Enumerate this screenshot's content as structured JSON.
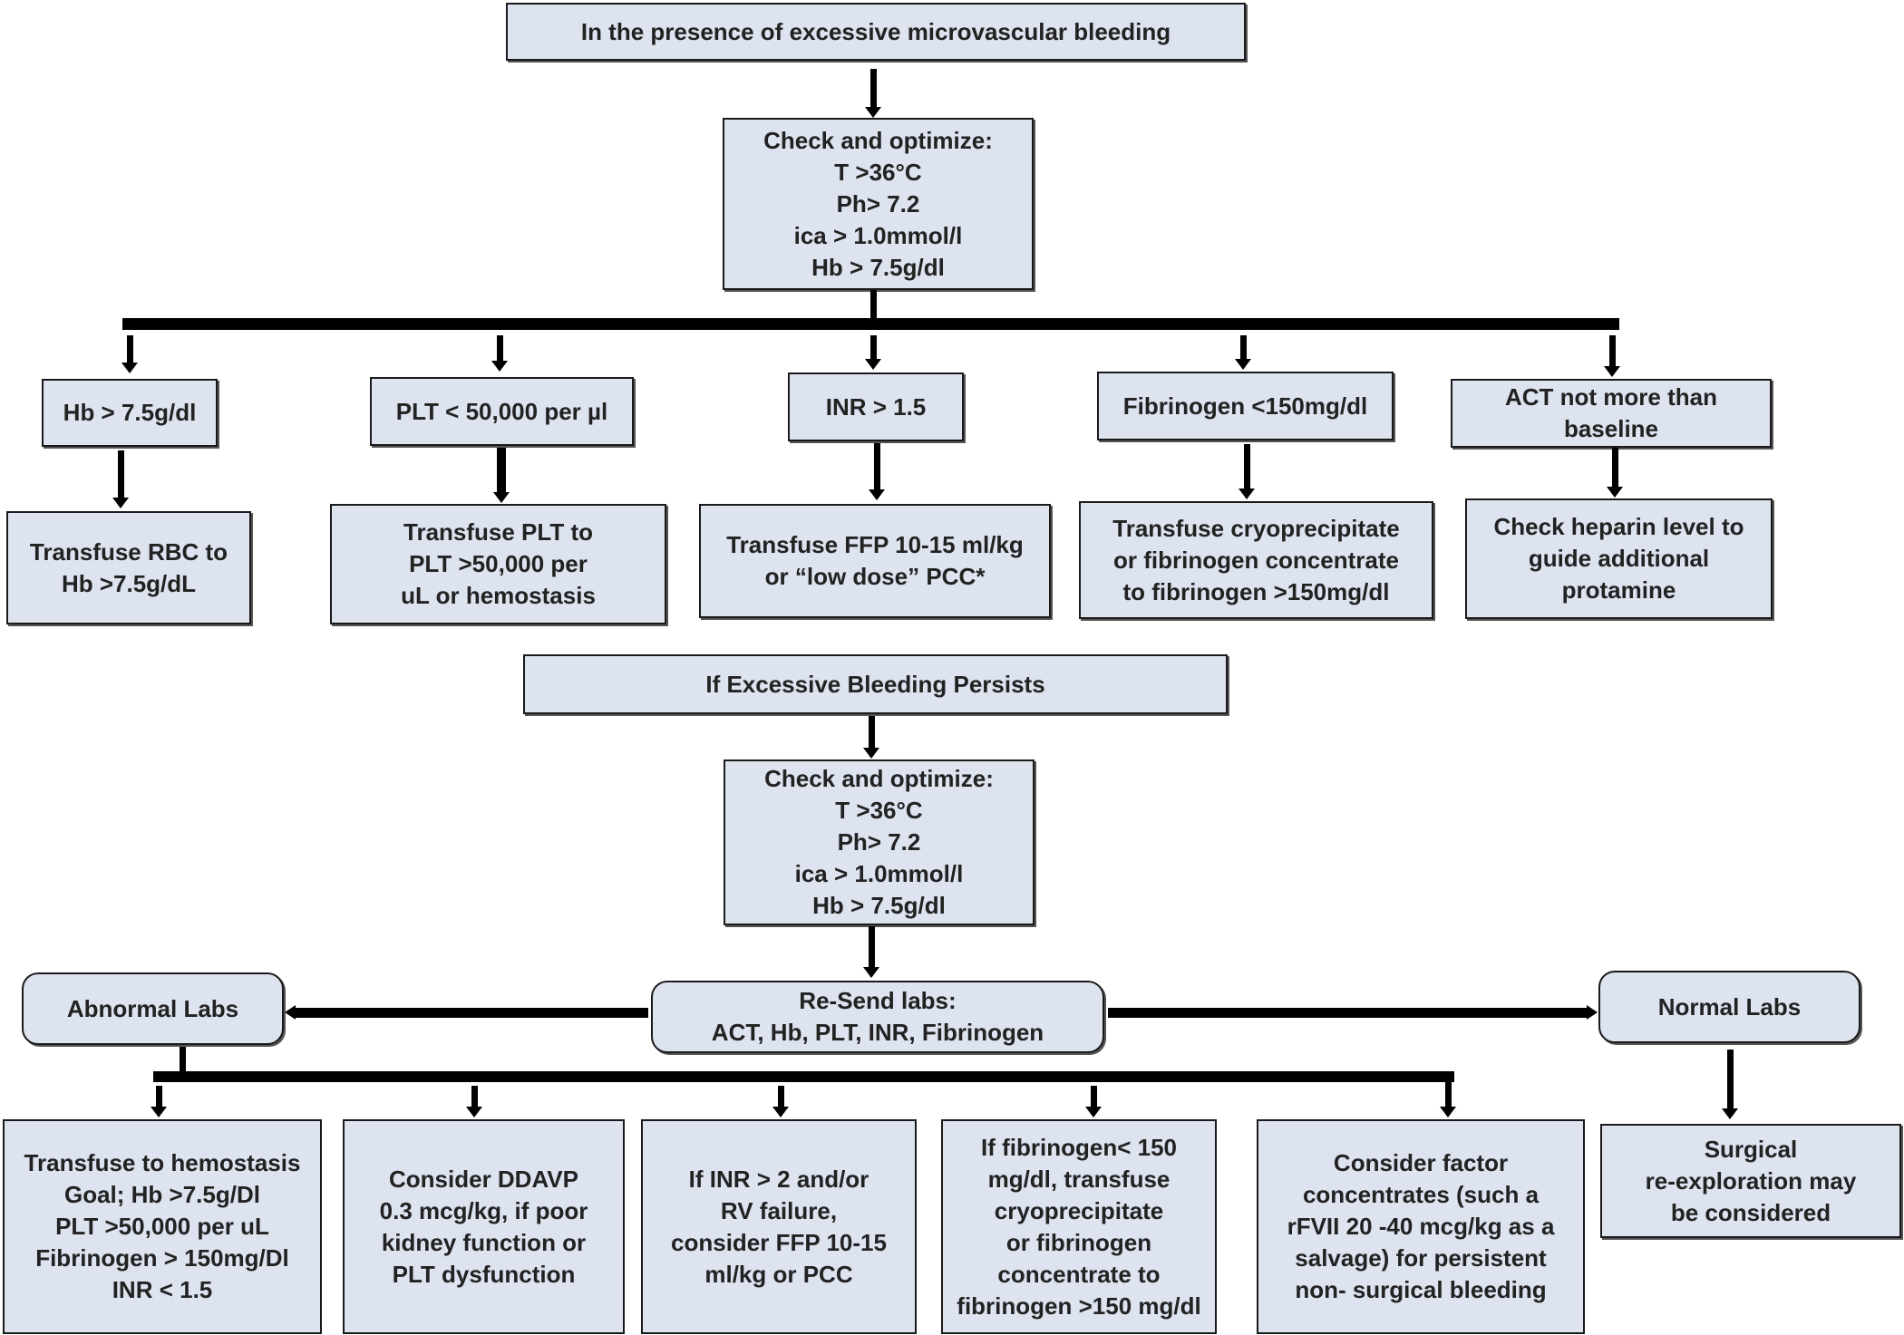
{
  "section1": {
    "title": "In the presence of  excessive microvascular  bleeding",
    "check": "Check and optimize:\nT >36°C\nPh> 7.2\nica > 1.0mmol/l\nHb > 7.5g/dl",
    "conditions": [
      {
        "label": "Hb > 7.5g/dl",
        "action": "Transfuse RBC to\nHb >7.5g/dL"
      },
      {
        "label": "PLT < 50,000 per µl",
        "action": "Transfuse PLT to\nPLT >50,000 per\nuL or hemostasis"
      },
      {
        "label": "INR > 1.5",
        "action": "Transfuse FFP 10-15 ml/kg\nor “low dose” PCC*"
      },
      {
        "label": "Fibrinogen <150mg/dl",
        "action": "Transfuse cryoprecipitate\nor fibrinogen concentrate\nto fibrinogen >150mg/dl"
      },
      {
        "label": "ACT not more than\nbaseline",
        "action": "Check heparin level to\nguide additional\nprotamine"
      }
    ]
  },
  "section2": {
    "title": "If Excessive Bleeding Persists",
    "check": "Check and optimize:\nT >36°C\nPh> 7.2\nica > 1.0mmol/l\nHb > 7.5g/dl",
    "resend": "Re-Send labs:\nACT, Hb, PLT, INR, Fibrinogen",
    "abnormal": "Abnormal Labs",
    "normal": "Normal Labs",
    "abnormal_actions": [
      "Transfuse to hemostasis\nGoal; Hb >7.5g/Dl\nPLT >50,000 per uL\nFibrinogen > 150mg/Dl\nINR < 1.5",
      "Consider DDAVP\n0.3 mcg/kg, if poor\nkidney function or\nPLT dysfunction",
      "If INR > 2 and/or\nRV failure,\nconsider FFP 10-15\nml/kg or PCC",
      "If fibrinogen< 150\nmg/dl, transfuse\ncryoprecipitate\nor fibrinogen\nconcentrate to\nfibrinogen >150 mg/dl",
      "Consider factor\nconcentrates (such a\nrFVII 20 -40 mcg/kg as a\nsalvage) for persistent\nnon- surgical bleeding"
    ],
    "normal_action": "Surgical\nre-exploration may\nbe considered"
  }
}
